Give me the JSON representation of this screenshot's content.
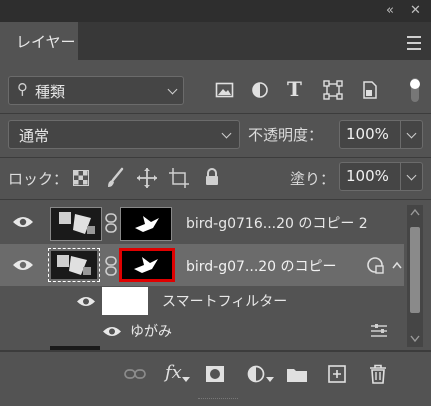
{
  "panel": {
    "tab_label": "レイヤー",
    "filter": {
      "label": "種類"
    },
    "blend_mode": "通常",
    "opacity_label": "不透明度：",
    "opacity_value": "100%",
    "lock_label": "ロック：",
    "fill_label": "塗り：",
    "fill_value": "100%"
  },
  "layers": [
    {
      "name": "bird-g0716...20 のコピー 2",
      "selected": false
    },
    {
      "name": "bird-g07...20 のコピー",
      "selected": true
    }
  ],
  "smart_filter": {
    "label": "スマートフィルター",
    "items": [
      {
        "name": "ゆがみ"
      }
    ]
  },
  "footer": {
    "fx_label": "fx"
  }
}
